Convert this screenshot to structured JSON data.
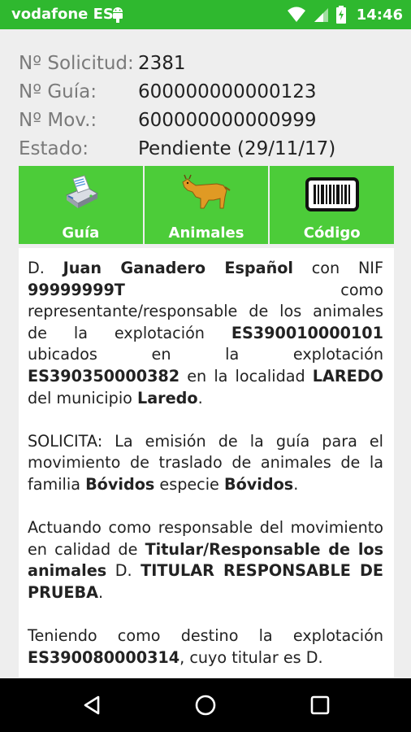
{
  "status_bar": {
    "carrier": "vodafone ES",
    "time": "14:46",
    "icons": [
      "android-debug-icon",
      "wifi-icon",
      "signal-icon",
      "battery-charging-icon"
    ]
  },
  "info": {
    "solicitud_label": "Nº Solicitud:",
    "solicitud_value": "2381",
    "guia_label": "Nº Guía:",
    "guia_value": "600000000000123",
    "mov_label": "Nº Mov.:",
    "mov_value": "600000000000999",
    "estado_label": "Estado:",
    "estado_value": "Pendiente (29/11/17)"
  },
  "toolbar": {
    "colors": {
      "button": "#4ccc39",
      "status_bar": "#2fb82f"
    },
    "buttons": [
      {
        "label": "Guía",
        "icon": "printer-icon"
      },
      {
        "label": "Animales",
        "icon": "cow-icon"
      },
      {
        "label": "Código",
        "icon": "barcode-icon"
      }
    ]
  },
  "document": {
    "p1": {
      "t1": "D. ",
      "b1": "Juan Ganadero Español",
      "t2": " con NIF ",
      "b2": "99999999T",
      "t3": " como representante/responsable de los animales de la explotación ",
      "b3": "ES390010000101",
      "t4": " ubicados en la explotación ",
      "b4": "ES390350000382",
      "t5": " en la localidad ",
      "b5": "LAREDO",
      "t6": " del municipio ",
      "b6": "Laredo",
      "t7": "."
    },
    "p2": {
      "t1": "SOLICITA: La emisión de la guía para el movimiento de traslado de animales de la familia ",
      "b1": "Bóvidos",
      "t2": " especie ",
      "b2": "Bóvidos",
      "t3": "."
    },
    "p3": {
      "t1": "Actuando como responsable del movimiento en calidad de ",
      "b1": "Titular/Responsable de los animales",
      "t2": " D. ",
      "b2": "TITULAR RESPONSABLE DE PRUEBA",
      "t3": "."
    },
    "p4": {
      "t1": "Teniendo como destino la explotación ",
      "b1": "ES390080000314",
      "t2": ", cuyo titular es D."
    }
  },
  "nav_bar": {
    "buttons": [
      "back-icon",
      "home-icon",
      "recents-icon"
    ]
  }
}
